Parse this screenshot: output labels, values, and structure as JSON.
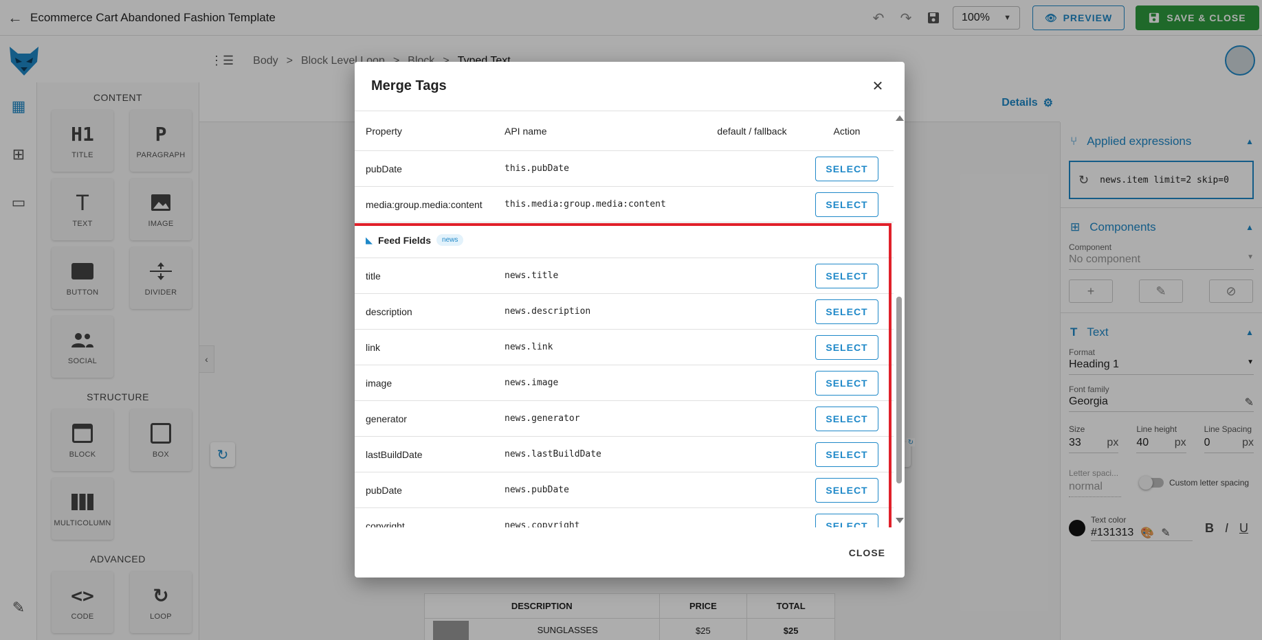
{
  "topbar": {
    "title": "Ecommerce Cart Abandoned Fashion Template",
    "zoom": "100%",
    "preview_label": "PREVIEW",
    "save_close_label": "SAVE & CLOSE"
  },
  "breadcrumb": [
    "Body",
    "Block Level Loop",
    "Block",
    "Typed Text"
  ],
  "left_panel": {
    "content_title": "CONTENT",
    "content_tiles": [
      {
        "icon": "H1",
        "label": "TITLE"
      },
      {
        "icon": "P",
        "label": "PARAGRAPH"
      },
      {
        "icon": "T",
        "label": "TEXT"
      },
      {
        "icon": "image-icon",
        "label": "IMAGE"
      },
      {
        "icon": "button-icon",
        "label": "BUTTON"
      },
      {
        "icon": "divider-icon",
        "label": "DIVIDER"
      },
      {
        "icon": "social-icon",
        "label": "SOCIAL"
      }
    ],
    "structure_title": "STRUCTURE",
    "structure_tiles": [
      {
        "icon": "block-icon",
        "label": "BLOCK"
      },
      {
        "icon": "box-icon",
        "label": "BOX"
      },
      {
        "icon": "multicolumn-icon",
        "label": "MULTICOLUMN"
      }
    ],
    "advanced_title": "ADVANCED",
    "advanced_tiles": [
      {
        "icon": "code-icon",
        "label": "CODE"
      },
      {
        "icon": "loop-icon",
        "label": "LOOP"
      }
    ]
  },
  "canvas": {
    "details_label": "Details",
    "email_table": {
      "headers": [
        "DESCRIPTION",
        "PRICE",
        "TOTAL"
      ],
      "row": {
        "description": "SUNGLASSES",
        "price": "$25",
        "total": "$25"
      }
    }
  },
  "right_panel": {
    "applied_expressions_title": "Applied expressions",
    "expression": "news.item limit=2 skip=0",
    "components_title": "Components",
    "component_label": "Component",
    "component_value": "No component",
    "text_title": "Text",
    "format_label": "Format",
    "format_value": "Heading 1",
    "font_family_label": "Font family",
    "font_family_value": "Georgia",
    "size_label": "Size",
    "size_value": "33",
    "line_height_label": "Line height",
    "line_height_value": "40",
    "line_spacing_label": "Line Spacing",
    "line_spacing_value": "0",
    "unit": "px",
    "letter_spacing_label": "Letter spaci...",
    "letter_spacing_value": "normal",
    "custom_letter_spacing_label": "Custom letter spacing",
    "text_color_label": "Text color",
    "text_color_value": "#131313",
    "format_buttons": [
      "B",
      "I",
      "U"
    ]
  },
  "modal": {
    "title": "Merge Tags",
    "columns": [
      "Property",
      "API name",
      "default / fallback",
      "Action"
    ],
    "top_rows": [
      {
        "property": "pubDate",
        "api": "this.pubDate",
        "action": "SELECT"
      },
      {
        "property": "media:group.media:content",
        "api": "this.media:group.media:content",
        "action": "SELECT"
      }
    ],
    "group": {
      "title": "Feed Fields",
      "chip": "news"
    },
    "feed_rows": [
      {
        "property": "title",
        "api": "news.title",
        "action": "SELECT"
      },
      {
        "property": "description",
        "api": "news.description",
        "action": "SELECT"
      },
      {
        "property": "link",
        "api": "news.link",
        "action": "SELECT"
      },
      {
        "property": "image",
        "api": "news.image",
        "action": "SELECT"
      },
      {
        "property": "generator",
        "api": "news.generator",
        "action": "SELECT"
      },
      {
        "property": "lastBuildDate",
        "api": "news.lastBuildDate",
        "action": "SELECT"
      },
      {
        "property": "pubDate",
        "api": "news.pubDate",
        "action": "SELECT"
      },
      {
        "property": "copyright",
        "api": "news.copyright",
        "action": "SELECT"
      }
    ],
    "close_label": "CLOSE"
  },
  "colors": {
    "accent": "#1e88c8",
    "save_green": "#2e9b3f",
    "highlight_red": "#e0202a",
    "text_color_swatch": "#131313"
  }
}
